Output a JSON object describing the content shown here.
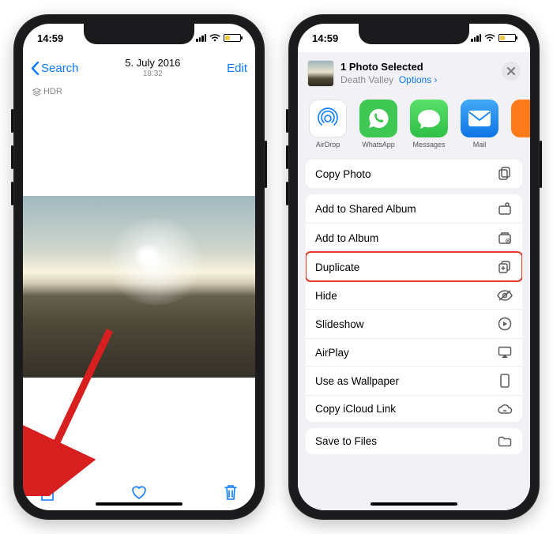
{
  "statusbar": {
    "time": "14:59"
  },
  "left": {
    "back_label": "Search",
    "title": "5. July 2016",
    "subtitle": "18:32",
    "edit_label": "Edit",
    "hdr_badge": "HDR"
  },
  "right": {
    "selected_title": "1 Photo Selected",
    "location": "Death Valley",
    "options_label": "Options",
    "apps": {
      "airdrop": "AirDrop",
      "whatsapp": "WhatsApp",
      "messages": "Messages",
      "mail": "Mail"
    },
    "actions": {
      "copy_photo": "Copy Photo",
      "add_shared": "Add to Shared Album",
      "add_album": "Add to Album",
      "duplicate": "Duplicate",
      "hide": "Hide",
      "slideshow": "Slideshow",
      "airplay": "AirPlay",
      "wallpaper": "Use as Wallpaper",
      "icloud_link": "Copy iCloud Link",
      "save_files": "Save to Files"
    }
  }
}
